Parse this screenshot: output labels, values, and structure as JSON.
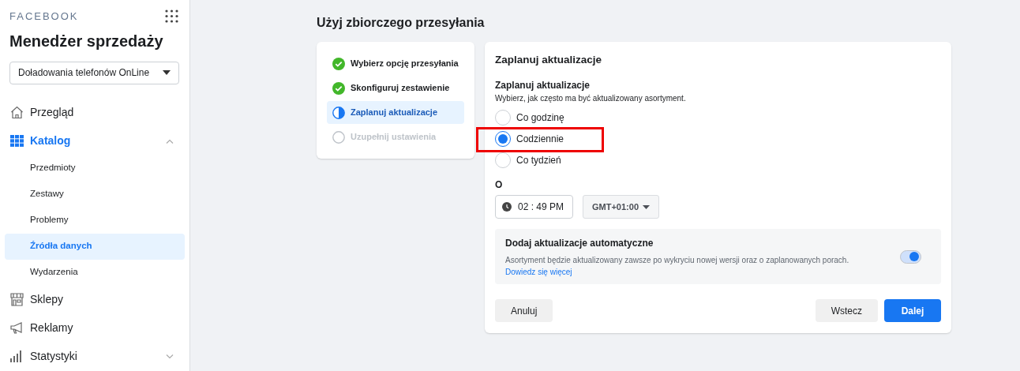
{
  "brand": "FACEBOOK",
  "app_title": "Menedżer sprzedaży",
  "account_select": {
    "value": "Doładowania telefonów OnLine"
  },
  "nav": [
    {
      "label": "Przegląd",
      "selected": false
    },
    {
      "label": "Katalog",
      "selected": true,
      "expanded": true,
      "children": [
        {
          "label": "Przedmioty",
          "selected": false
        },
        {
          "label": "Zestawy",
          "selected": false
        },
        {
          "label": "Problemy",
          "selected": false
        },
        {
          "label": "Źródła danych",
          "selected": true
        },
        {
          "label": "Wydarzenia",
          "selected": false
        }
      ]
    },
    {
      "label": "Sklepy",
      "selected": false
    },
    {
      "label": "Reklamy",
      "selected": false
    },
    {
      "label": "Statystyki",
      "selected": false,
      "expanded": false
    }
  ],
  "page_title": "Użyj zbiorczego przesyłania",
  "steps": [
    {
      "label": "Wybierz opcję przesyłania",
      "completed": true,
      "selected": false
    },
    {
      "label": "Skonfiguruj zestawienie",
      "completed": true,
      "selected": false
    },
    {
      "label": "Zaplanuj aktualizacje",
      "completed": false,
      "selected": true
    },
    {
      "label": "Uzupełnij ustawienia",
      "completed": false,
      "selected": false
    }
  ],
  "form": {
    "title": "Zaplanuj aktualizacje",
    "section_label": "Zaplanuj aktualizacje",
    "section_hint": "Wybierz, jak często ma być aktualizowany asortyment.",
    "options": [
      {
        "label": "Co godzinę",
        "selected": false,
        "highlighted": false
      },
      {
        "label": "Codziennie",
        "selected": true,
        "highlighted": true
      },
      {
        "label": "Co tydzień",
        "selected": false,
        "highlighted": false
      }
    ],
    "time_label": "O",
    "time": {
      "hours": "02",
      "separator": ":",
      "minutes": "49",
      "period": "PM"
    },
    "timezone": "GMT+01:00",
    "auto_update": {
      "title": "Dodaj aktualizacje automatyczne",
      "description": "Asortyment będzie aktualizowany zawsze po wykryciu nowej wersji oraz o zaplanowanych porach.",
      "link": "Dowiedz się więcej",
      "on": true
    },
    "buttons": [
      {
        "label": "Anuluj",
        "kind": "secondary"
      },
      {
        "label": "Wstecz",
        "kind": "secondary"
      },
      {
        "label": "Dalej",
        "kind": "primary"
      }
    ]
  }
}
